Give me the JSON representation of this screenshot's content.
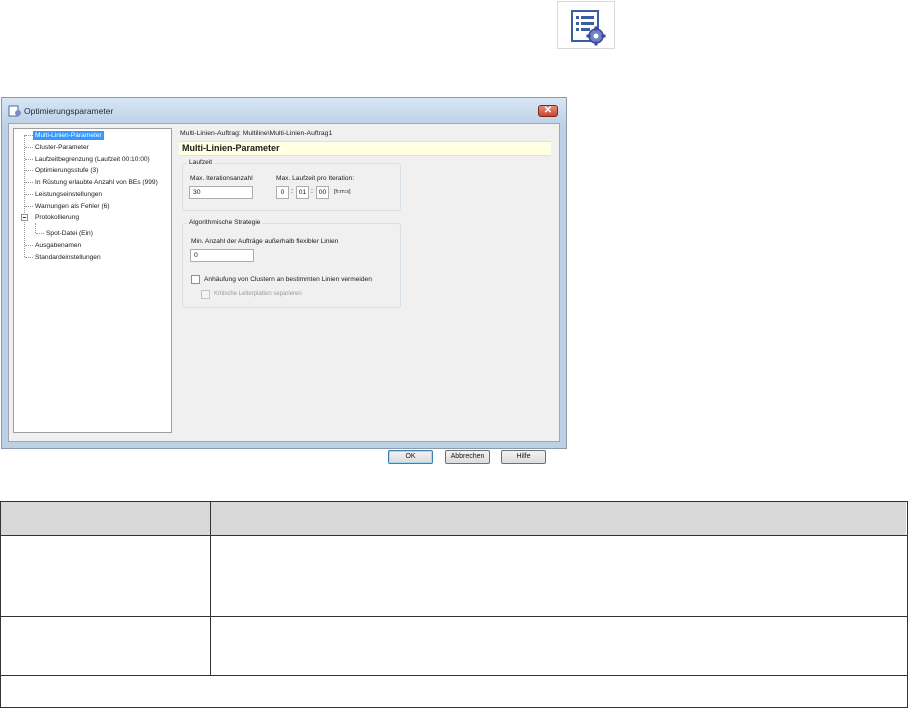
{
  "dialog": {
    "title": "Optimierungsparameter",
    "close_glyph": "✕",
    "tree": {
      "items": [
        {
          "label": "Multi-Linien-Parameter",
          "selected": true
        },
        {
          "label": "Cluster-Parameter"
        },
        {
          "label": "Laufzeitbegrenzung (Laufzeit 00:10:00)"
        },
        {
          "label": "Optimierungsstufe (3)"
        },
        {
          "label": "In Rüstung erlaubte Anzahl von BEs (999)"
        },
        {
          "label": "Leistungseinstellungen"
        },
        {
          "label": "Warnungen als Fehler (6)"
        },
        {
          "label": "Protokollierung"
        },
        {
          "label": "Spot-Datei (Ein)"
        },
        {
          "label": "Ausgabenamen"
        },
        {
          "label": "Standardeinstellungen"
        }
      ]
    },
    "path": "Multi-Linien-Auftrag: Multiline\\Multi-Linien-Auftrag1",
    "header": "Multi-Linien-Parameter",
    "laufzeit": {
      "title": "Laufzeit",
      "max_iter_label": "Max. Iterationsanzahl",
      "max_iter_value": "30",
      "max_runtime_label": "Max. Laufzeit pro Iteration:",
      "hours": "0",
      "minutes": "01",
      "seconds": "00",
      "unit": "[h:m:s]"
    },
    "strategy": {
      "title": "Algorithmische Strategie",
      "min_orders_label": "Min. Anzahl der Aufträge außerhalb flexibler Linien",
      "min_orders_value": "0",
      "avoid_cluster_label": "Anhäufung von Clustern an bestimmten Linien vermeiden",
      "avoid_cluster_checked": false,
      "separate_label": "Kritische Leiterplatten separieren",
      "separate_checked": false
    },
    "buttons": {
      "ok": "OK",
      "cancel": "Abbrechen",
      "help": "Hilfe"
    }
  },
  "icons": {
    "toolbar": "settings-list-gear-icon",
    "dialog": "optimizer-icon"
  },
  "colors": {
    "selection": "#3399ff",
    "header_bar": "#ffffe1",
    "table_header": "#d9d9d9"
  }
}
